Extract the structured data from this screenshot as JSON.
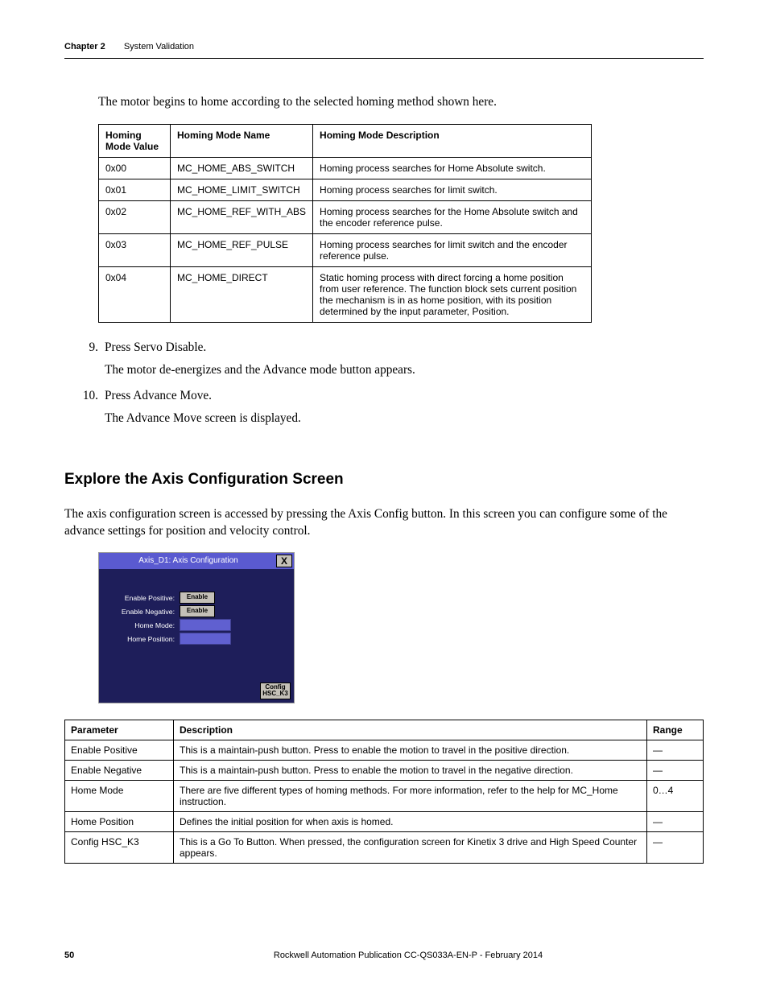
{
  "header": {
    "chapter": "Chapter 2",
    "section": "System Validation"
  },
  "intro": "The motor begins to home according to the selected homing method shown here.",
  "homing_table": {
    "headers": [
      "Homing Mode Value",
      "Homing Mode Name",
      "Homing Mode Description"
    ],
    "rows": [
      [
        "0x00",
        "MC_HOME_ABS_SWITCH",
        "Homing process searches for Home Absolute switch."
      ],
      [
        "0x01",
        "MC_HOME_LIMIT_SWITCH",
        "Homing process searches for limit switch."
      ],
      [
        "0x02",
        "MC_HOME_REF_WITH_ABS",
        "Homing process searches for the Home Absolute switch and the encoder reference pulse."
      ],
      [
        "0x03",
        "MC_HOME_REF_PULSE",
        "Homing process searches for limit switch and the encoder reference pulse."
      ],
      [
        "0x04",
        "MC_HOME_DIRECT",
        "Static homing process with direct forcing a home position from user reference. The function block sets current position the mechanism is in as home position, with its position determined by the input parameter, Position."
      ]
    ]
  },
  "steps": [
    {
      "num": "9.",
      "line1": "Press Servo Disable.",
      "line2": "The motor de-energizes and the Advance mode button appears."
    },
    {
      "num": "10.",
      "line1": "Press Advance Move.",
      "line2": "The Advance Move screen is displayed."
    }
  ],
  "heading2": "Explore the Axis Configuration Screen",
  "body2": "The axis configuration screen is accessed by pressing the Axis Config button. In this screen you can configure some of the advance settings for position and velocity control.",
  "axis_screen": {
    "title": "Axis_D1: Axis Configuration",
    "close": "X",
    "rows": [
      {
        "label": "Enable Positive:",
        "type": "button",
        "text": "Enable"
      },
      {
        "label": "Enable Negative:",
        "type": "button",
        "text": "Enable"
      },
      {
        "label": "Home Mode:",
        "type": "field"
      },
      {
        "label": "Home Position:",
        "type": "field"
      }
    ],
    "config_btn_l1": "Config",
    "config_btn_l2": "HSC_K3"
  },
  "param_table": {
    "headers": [
      "Parameter",
      "Description",
      "Range"
    ],
    "rows": [
      [
        "Enable Positive",
        "This is a maintain-push button. Press to enable the motion to travel in the positive direction.",
        "—"
      ],
      [
        "Enable Negative",
        "This is a maintain-push button. Press to enable the motion to travel in the negative direction.",
        "—"
      ],
      [
        "Home Mode",
        "There are five different types of homing methods. For more information, refer to the help for MC_Home instruction.",
        "0…4"
      ],
      [
        "Home Position",
        "Defines the initial position for when axis is homed.",
        "—"
      ],
      [
        "Config HSC_K3",
        "This is a Go To Button. When pressed, the configuration screen for Kinetix 3 drive and High Speed Counter appears.",
        "—"
      ]
    ]
  },
  "footer": {
    "page": "50",
    "pub": "Rockwell Automation Publication CC-QS033A-EN-P - February 2014"
  }
}
